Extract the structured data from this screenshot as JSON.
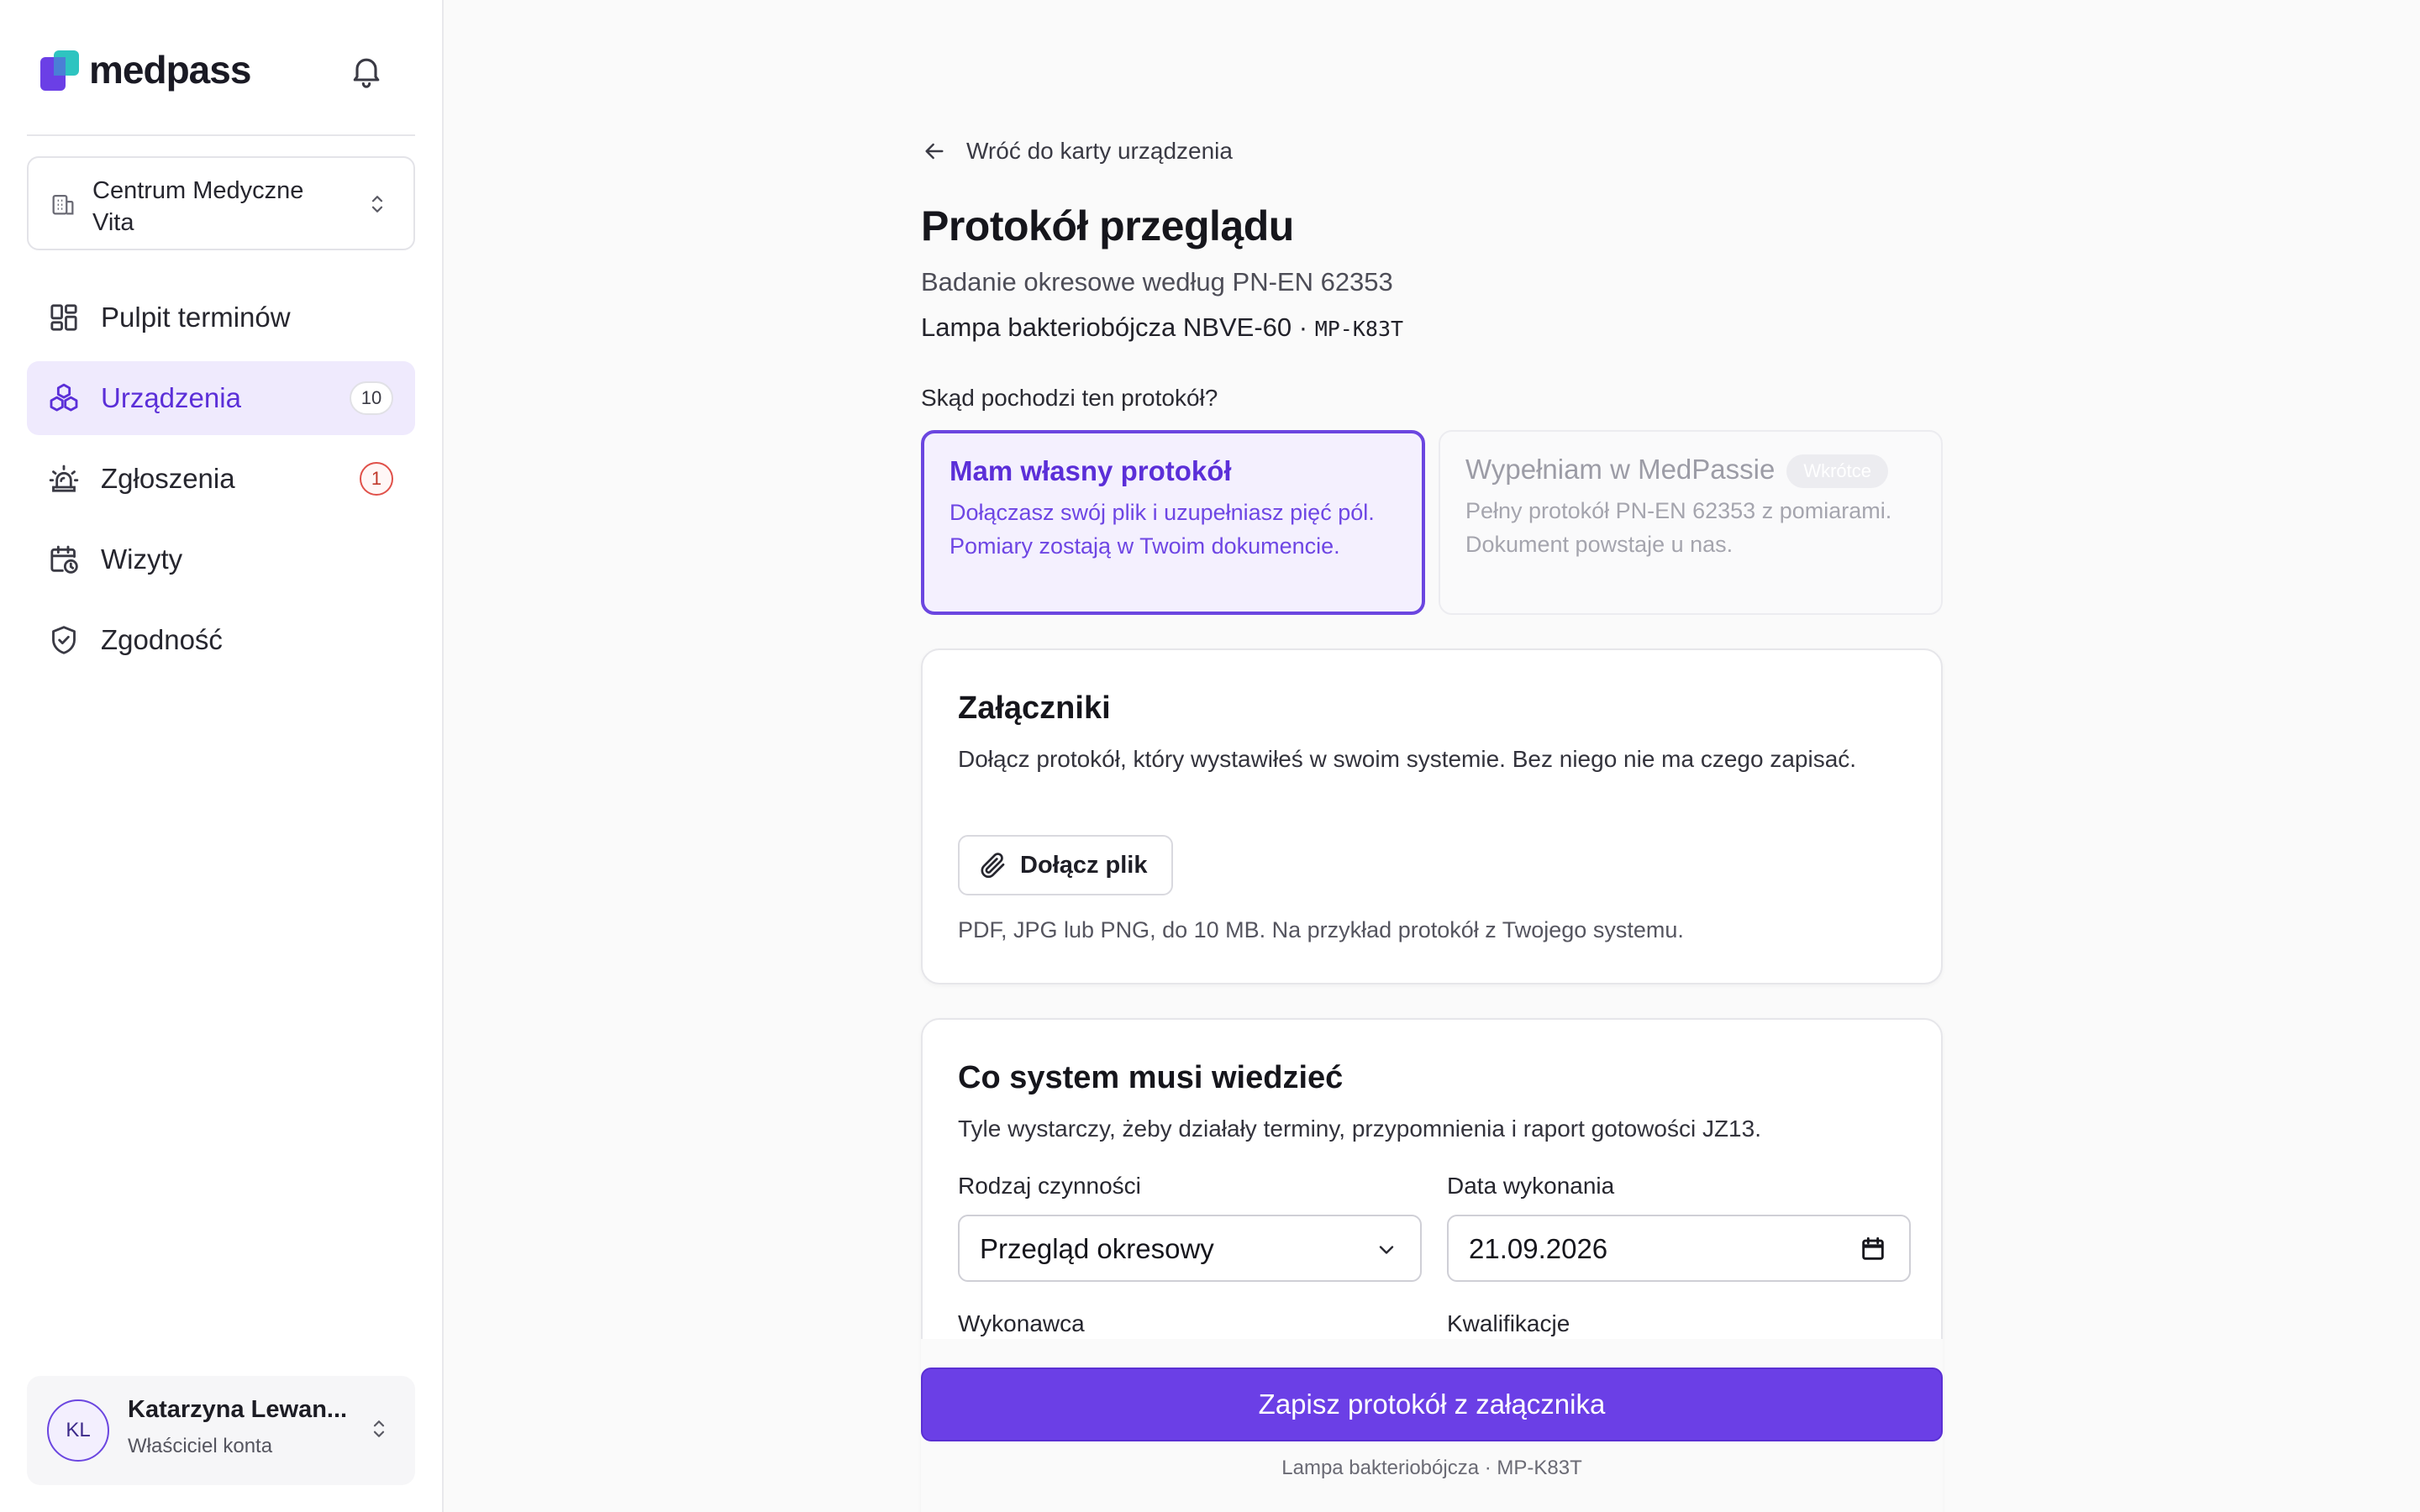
{
  "app": {
    "brand": "medpass"
  },
  "colors": {
    "accent": "#6b3fe6",
    "accent_soft": "#f4f0fe",
    "alert": "#e0514a"
  },
  "sidebar": {
    "org": {
      "name": "Centrum Medyczne Vita",
      "icon": "building-icon"
    },
    "items": [
      {
        "label": "Pulpit terminów",
        "icon": "dashboard-icon",
        "active": false
      },
      {
        "label": "Urządzenia",
        "icon": "cubes-icon",
        "active": true,
        "badge": "10"
      },
      {
        "label": "Zgłoszenia",
        "icon": "alarm-icon",
        "active": false,
        "badge": "1"
      },
      {
        "label": "Wizyty",
        "icon": "calendar-clock-icon",
        "active": false
      },
      {
        "label": "Zgodność",
        "icon": "shield-check-icon",
        "active": false
      }
    ],
    "user": {
      "initials": "KL",
      "name": "Katarzyna Lewan...",
      "role": "Właściciel konta"
    }
  },
  "main": {
    "back_label": "Wróć do karty urządzenia",
    "title": "Protokół przeglądu",
    "subtitle": "Badanie okresowe według PN-EN 62353",
    "device_name": "Lampa bakteriobójcza NBVE-60 · ",
    "device_code": "MP-K83T",
    "question": "Skąd pochodzi ten protokół?",
    "options": [
      {
        "title": "Mam własny protokół",
        "desc": "Dołączasz swój plik i uzupełniasz pięć pól. Pomiary zostają w Twoim dokumencie.",
        "selected": true
      },
      {
        "title": "Wypełniam w MedPassie",
        "badge": "Wkrótce",
        "desc": "Pełny protokół PN-EN 62353 z pomiarami. Dokument powstaje u nas.",
        "selected": false
      }
    ],
    "attachments": {
      "title": "Załączniki",
      "desc": "Dołącz protokół, który wystawiłeś w swoim systemie. Bez niego nie ma czego zapisać.",
      "button": "Dołącz plik",
      "hint": "PDF, JPG lub PNG, do 10 MB. Na przykład protokół z Twojego systemu."
    },
    "info": {
      "title": "Co system musi wiedzieć",
      "desc": "Tyle wystarczy, żeby działały terminy, przypomnienia i raport gotowości JZ13.",
      "fields": {
        "activity_label": "Rodzaj czynności",
        "activity_value": "Przegląd okresowy",
        "date_label": "Data wykonania",
        "date_value": "21.09.2026",
        "performer_label": "Wykonawca",
        "qualifications_label": "Kwalifikacje"
      }
    },
    "save_button": "Zapisz protokół z załącznika",
    "footer": "Lampa bakteriobójcza · MP-K83T"
  }
}
